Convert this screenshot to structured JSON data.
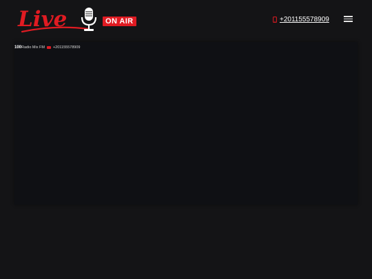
{
  "header": {
    "logo": {
      "word": "Live",
      "badge": "ON AIR",
      "icons": [
        "microphone-icon"
      ]
    },
    "phone": {
      "icon": "mobile-phone-icon",
      "number": "+201155578909"
    },
    "menu_icon": "hamburger-menu-icon"
  },
  "player": {
    "number": "100",
    "title": "Radio Mix FM",
    "phone": "+201155578909",
    "flag_icon": "flag-icon"
  },
  "colors": {
    "background": "#141416",
    "player_background": "#0f1014",
    "accent": "#e01b22",
    "text": "#ffffff"
  }
}
